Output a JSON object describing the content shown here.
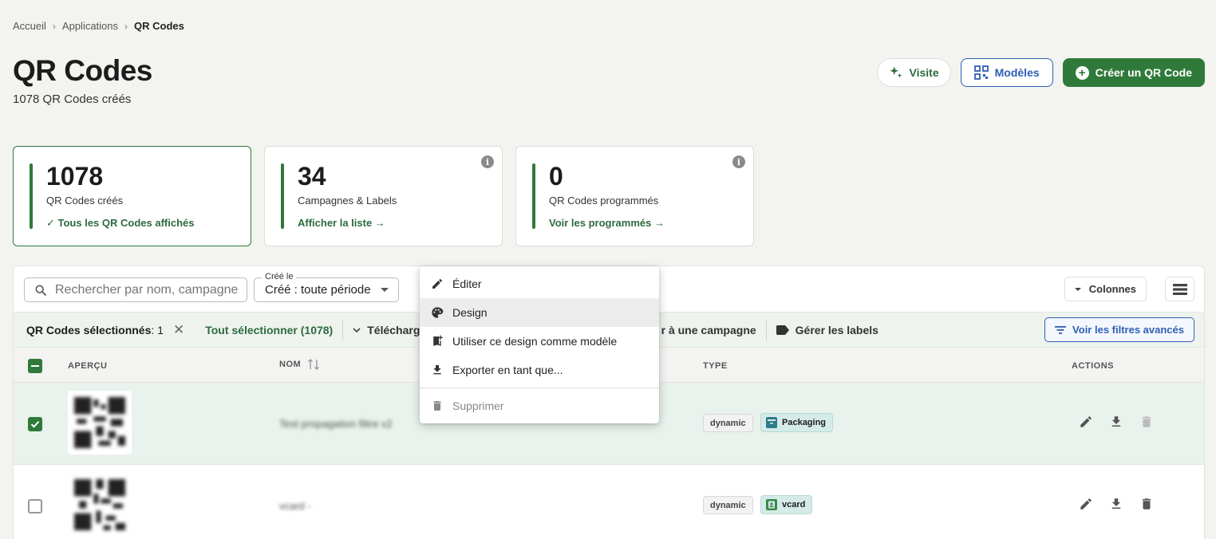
{
  "breadcrumb": [
    "Accueil",
    "Applications",
    "QR Codes"
  ],
  "page": {
    "title": "QR Codes",
    "subtitle": "1078 QR Codes créés"
  },
  "actions": {
    "visit": "Visite",
    "templates": "Modèles",
    "create": "Créer un QR Code"
  },
  "stats": [
    {
      "value": "1078",
      "label": "QR Codes créés",
      "link": "✓ Tous les QR Codes affichés"
    },
    {
      "value": "34",
      "label": "Campagnes & Labels",
      "link": "Afficher la liste →"
    },
    {
      "value": "0",
      "label": "QR Codes programmés",
      "link": "Voir les programmés →"
    }
  ],
  "toolbar": {
    "search_placeholder": "Rechercher par nom, campagne",
    "date_label": "Créé le",
    "date_value": "Créé : toute période",
    "columns": "Colonnes"
  },
  "selection": {
    "count_label": "QR Codes sélectionnés",
    "count_value": ": 1",
    "select_all": "Tout sélectionner (1078)",
    "download": "Télécharger",
    "add_campaign": "r à une campagne",
    "manage_labels": "Gérer les labels",
    "advanced_filters": "Voir les filtres avancés"
  },
  "table": {
    "headers": {
      "preview": "APERÇU",
      "name": "NOM",
      "type": "TYPE",
      "actions": "ACTIONS"
    },
    "rows": [
      {
        "name": "Test propagation filtre v2",
        "type": "dynamic",
        "label": "Packaging",
        "selected": true
      },
      {
        "name": "vcard -",
        "type": "dynamic",
        "label": "vcard",
        "selected": false
      }
    ]
  },
  "context_menu": {
    "items": [
      "Éditer",
      "Design",
      "Utiliser ce design comme modèle",
      "Exporter en tant que...",
      "Supprimer"
    ]
  },
  "colors": {
    "primary": "#2f7a3a",
    "blue": "#2e5fb4",
    "teal_label": "#d5ebe8"
  }
}
